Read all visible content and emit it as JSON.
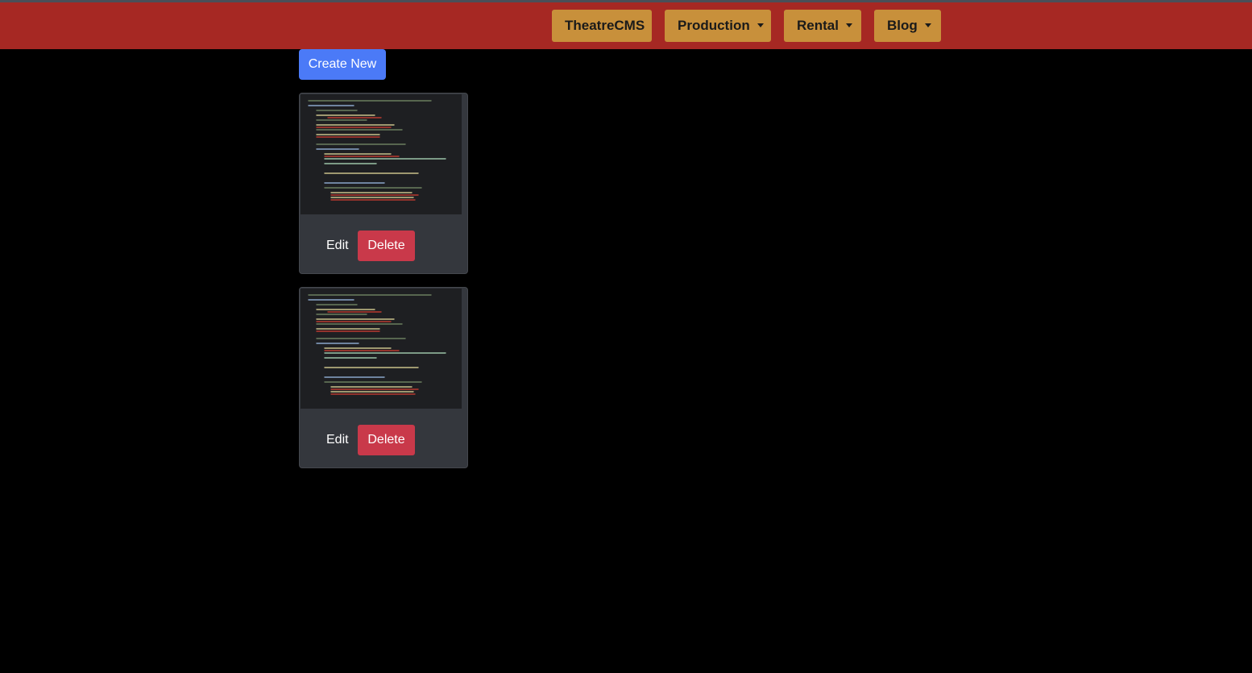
{
  "navbar": {
    "brand": "TheatreCMS",
    "menus": [
      {
        "label": "Production"
      },
      {
        "label": "Rental"
      },
      {
        "label": "Blog"
      }
    ]
  },
  "actions": {
    "create_label": "Create New"
  },
  "items": [
    {
      "edit_label": "Edit",
      "delete_label": "Delete"
    },
    {
      "edit_label": "Edit",
      "delete_label": "Delete"
    }
  ],
  "colors": {
    "navbar_bg": "#a62823",
    "nav_button_bg": "#c8903b",
    "create_button_bg": "#4b7af7",
    "delete_button_bg": "#c9394a",
    "card_bg": "#34373d",
    "page_bg": "#000000"
  }
}
